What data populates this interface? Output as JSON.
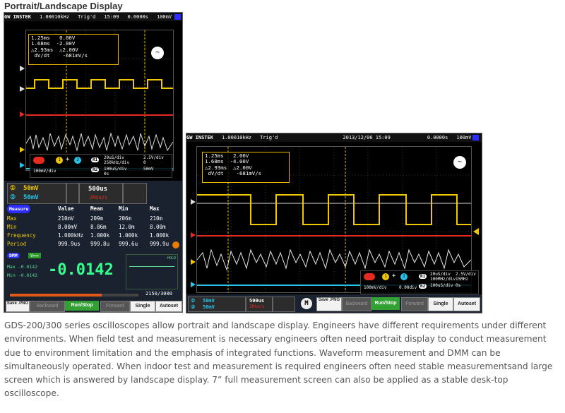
{
  "title": "Portrait/Landscape Display",
  "description": "GDS-200/300 series oscilloscopes allow portrait and landscape display. Engineers have different requirements under different environments. When field test and measurement is necessary engineers often need portrait display to conduct measurement due to environment limitation and the emphasis of integrated functions. Waveform measurement and DMM can be simultaneously operated. When indoor test and measurement is required engineers often need stable measurementsand large screen which is answered by landscape display. 7” full measurement screen can also be applied as a stable desk-top oscilloscope.",
  "colors": {
    "ch1": "#f0c800",
    "ch2": "#27c4e8",
    "ch3": "#e52b1f",
    "ch4": "#dcdcdc",
    "accent": "#2d2dff"
  },
  "portrait": {
    "status": {
      "brand": "GW INSTEK",
      "freq": "1.00010kHz",
      "trig": "Trig'd",
      "time": "15:09",
      "offset": "0.0000s",
      "level": "100mV"
    },
    "cursor": {
      "c1_t": "1.25ms",
      "c1_v": "0.00V",
      "c2_t": "1.68ms",
      "c2_v": "-2.00V",
      "dt": "△2.93ms",
      "dv": "△2.00V",
      "dvdt_lbl": "dV/dt",
      "dvdt": "-681mV/s"
    },
    "math": {
      "op": "+",
      "r1": "R1",
      "r2": "R2",
      "m_scale": "100mV/div",
      "r1_a": "20uS/div",
      "r1_b": "2.5V/div",
      "r1_c": "250kHz/div",
      "r1_d": "0",
      "r2_a": "100uS/div",
      "r2_b": "50mV",
      "r2_c": "0s"
    },
    "ch1_scale": "50mV",
    "ch2_scale": "50mV",
    "timebase": "500us",
    "samplerate": "2MSa/s",
    "meas_headers": {
      "measure": "Measure",
      "value": "Value",
      "mean": "Mean",
      "min": "Min",
      "max": "Max"
    },
    "meas_rows": [
      {
        "name": "Max",
        "value": "210mV",
        "mean": "209m",
        "min": "206m",
        "max": "210m"
      },
      {
        "name": "Min",
        "value": "8.00mV",
        "mean": "8.86m",
        "min": "12.0m",
        "max": "8.00m"
      },
      {
        "name": "Frequency",
        "value": "1.000kHz",
        "mean": "1.000k",
        "min": "1.000k",
        "max": "1.000k"
      },
      {
        "name": "Period",
        "value": "999.9us",
        "mean": "999.8u",
        "min": "999.6u",
        "max": "999.9u"
      }
    ],
    "dmm": {
      "label": "DMM",
      "mode": "V==",
      "reading": "-0.0142",
      "max_lbl": "Max -0.0142",
      "min_lbl": "Min -0.0142",
      "hold": "HOLD"
    },
    "progress": {
      "text": "2150/3000",
      "fraction": 0.7167
    },
    "buttons": {
      "save": "Save",
      "save_fmt": ".PNG",
      "backward": "Backward",
      "runstop": "Run/Stop",
      "forward": "Forward",
      "single": "Single",
      "autoset": "Autoset"
    }
  },
  "landscape": {
    "status": {
      "brand": "GW INSTEK",
      "freq": "1.00010kHz",
      "trig": "Trig'd",
      "date": "2013/12/06 15:09",
      "offset": "0.0000s",
      "level": "100mV"
    },
    "cursor": {
      "c1_t": "1.25ms",
      "c1_v": "2.00V",
      "c2_t": "1.68ms",
      "c2_v": "-4.00V",
      "dt": "△2.93ms",
      "dv": "△2.00V",
      "dvdt_lbl": "dV/dt",
      "dvdt": "-681mV/s"
    },
    "math": {
      "op": "+",
      "r1": "R1",
      "r2": "R2",
      "m_scale": "100mV/div",
      "m_off": "0.00div",
      "r1_a": "20uS/div",
      "r1_b": "2.5V/div",
      "r1_c": "100MHz/div",
      "r1_d": "15MHz",
      "r2_a": "100uS/div",
      "r2_b": "0s"
    },
    "ch1_scale": "50mV",
    "ch2_scale": "50mV",
    "timebase": "500us",
    "samplerate": "2MSa/s",
    "buttons": {
      "m": "M",
      "save": "Save",
      "save_fmt": ".PNG",
      "backward": "Backward",
      "runstop": "Run/Stop",
      "forward": "Forward",
      "single": "Single",
      "autoset": "Autoset"
    }
  }
}
